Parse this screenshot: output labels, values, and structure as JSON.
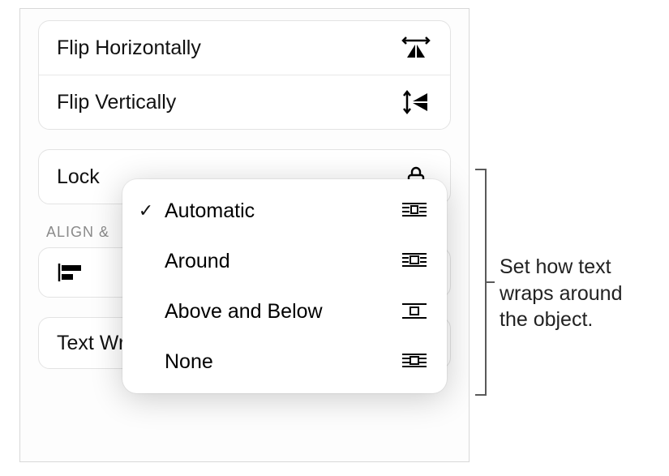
{
  "flip": {
    "horizontal": "Flip Horizontally",
    "vertical": "Flip Vertically"
  },
  "lock": {
    "label": "Lock"
  },
  "align_section": "ALIGN &",
  "textwrap": {
    "label": "Text Wrap",
    "value": "Automatic"
  },
  "popover": {
    "items": [
      {
        "label": "Automatic",
        "selected": true
      },
      {
        "label": "Around",
        "selected": false
      },
      {
        "label": "Above and Below",
        "selected": false
      },
      {
        "label": "None",
        "selected": false
      }
    ]
  },
  "callout": "Set how text wraps around the object."
}
